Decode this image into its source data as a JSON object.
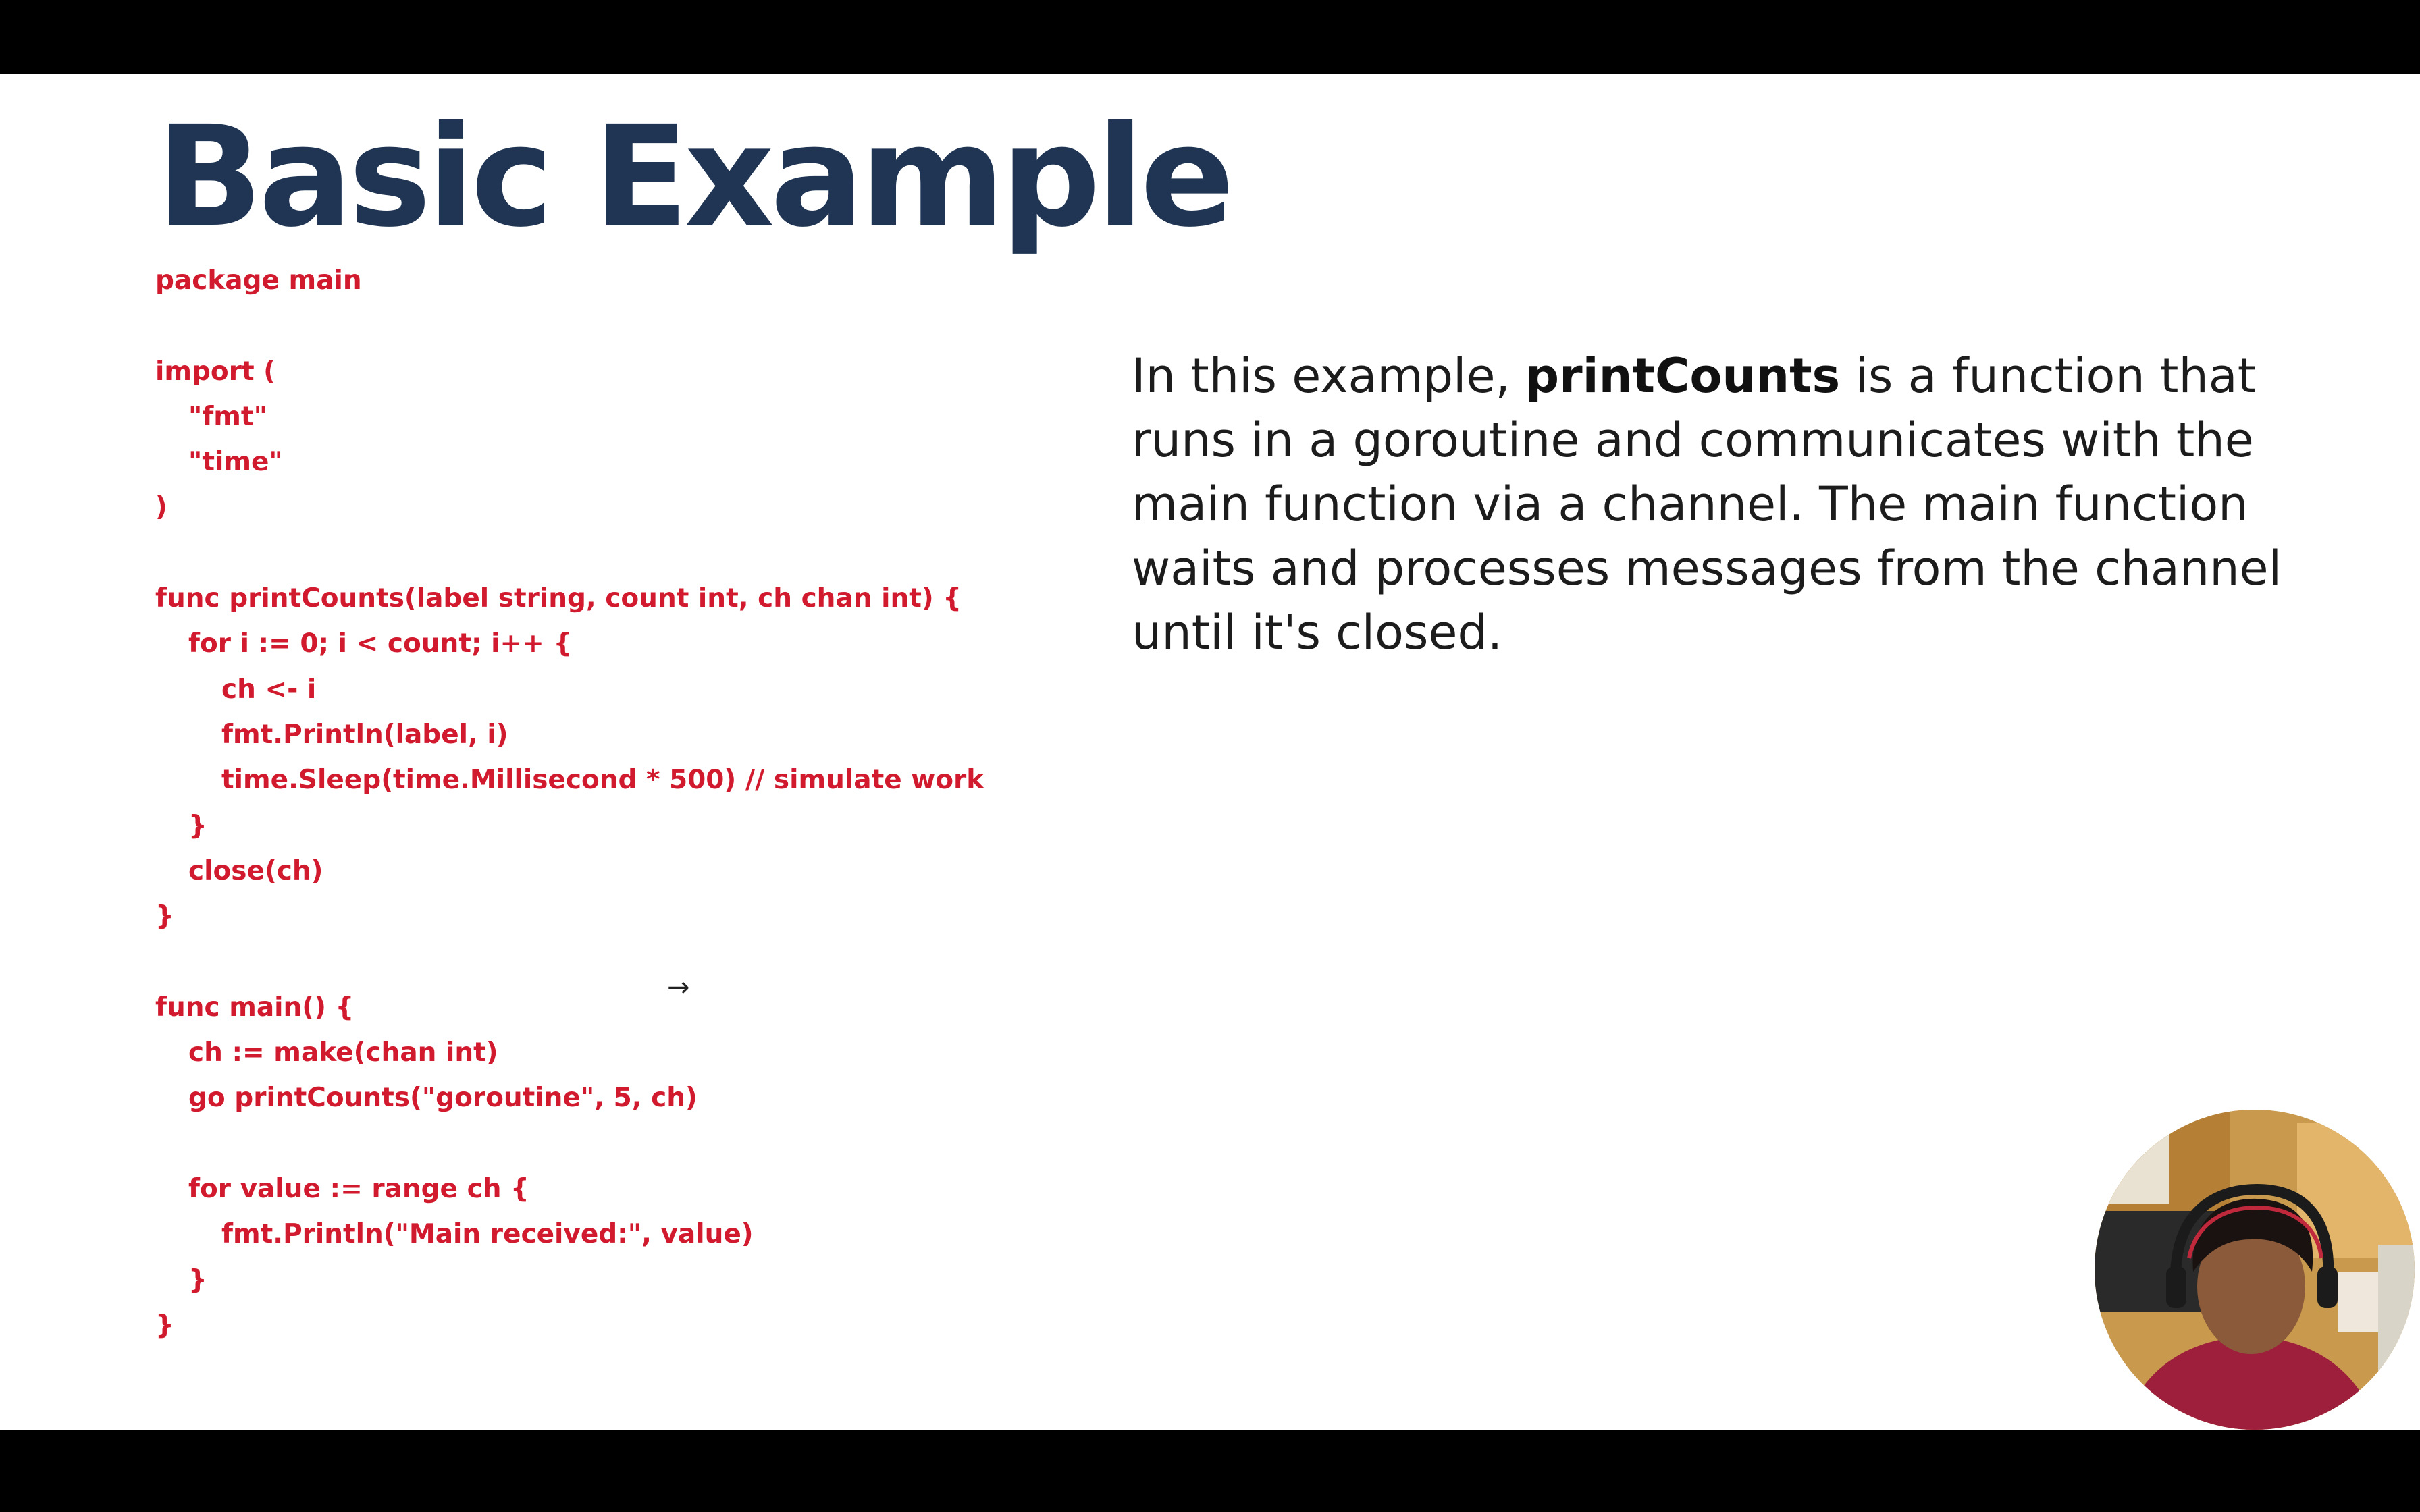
{
  "slide": {
    "title": "Basic Example",
    "code_lines": [
      {
        "text": "package main",
        "indent": 0
      },
      {
        "text": "",
        "indent": 0
      },
      {
        "text": "import (",
        "indent": 0
      },
      {
        "text": "\"fmt\"",
        "indent": 1
      },
      {
        "text": "\"time\"",
        "indent": 1
      },
      {
        "text": ")",
        "indent": 0
      },
      {
        "text": "",
        "indent": 0
      },
      {
        "text": "func printCounts(label string, count int, ch chan int) {",
        "indent": 0
      },
      {
        "text": "for i := 0; i < count; i++ {",
        "indent": 1
      },
      {
        "text": "ch <- i",
        "indent": 2
      },
      {
        "text": "fmt.Println(label, i)",
        "indent": 2
      },
      {
        "text": "time.Sleep(time.Millisecond * 500) // simulate work",
        "indent": 2
      },
      {
        "text": "}",
        "indent": 1
      },
      {
        "text": "close(ch)",
        "indent": 1
      },
      {
        "text": "}",
        "indent": 0
      },
      {
        "text": "",
        "indent": 0
      },
      {
        "text": "func main() {",
        "indent": 0
      },
      {
        "text": "ch := make(chan int)",
        "indent": 1
      },
      {
        "text": "go printCounts(\"goroutine\", 5, ch)",
        "indent": 1
      },
      {
        "text": "",
        "indent": 0
      },
      {
        "text": "for value := range ch {",
        "indent": 1
      },
      {
        "text": "fmt.Println(\"Main received:\", value)",
        "indent": 2
      },
      {
        "text": "}",
        "indent": 1
      },
      {
        "text": "}",
        "indent": 0
      }
    ],
    "description": {
      "before": "In this example, ",
      "highlight": "printCounts",
      "after": " is a function that runs in a goroutine and communicates with the main function via a channel. The main function waits and processes messages from the channel until it's closed."
    },
    "cursor_glyph": "→"
  },
  "icons": {
    "cursor": "mouse-pointer-arrow-icon"
  },
  "colors": {
    "title": "#1f3553",
    "code": "#d21a2e",
    "body_text": "#1c1c1c",
    "slide_background": "#ffffff",
    "letterbox": "#000000"
  }
}
